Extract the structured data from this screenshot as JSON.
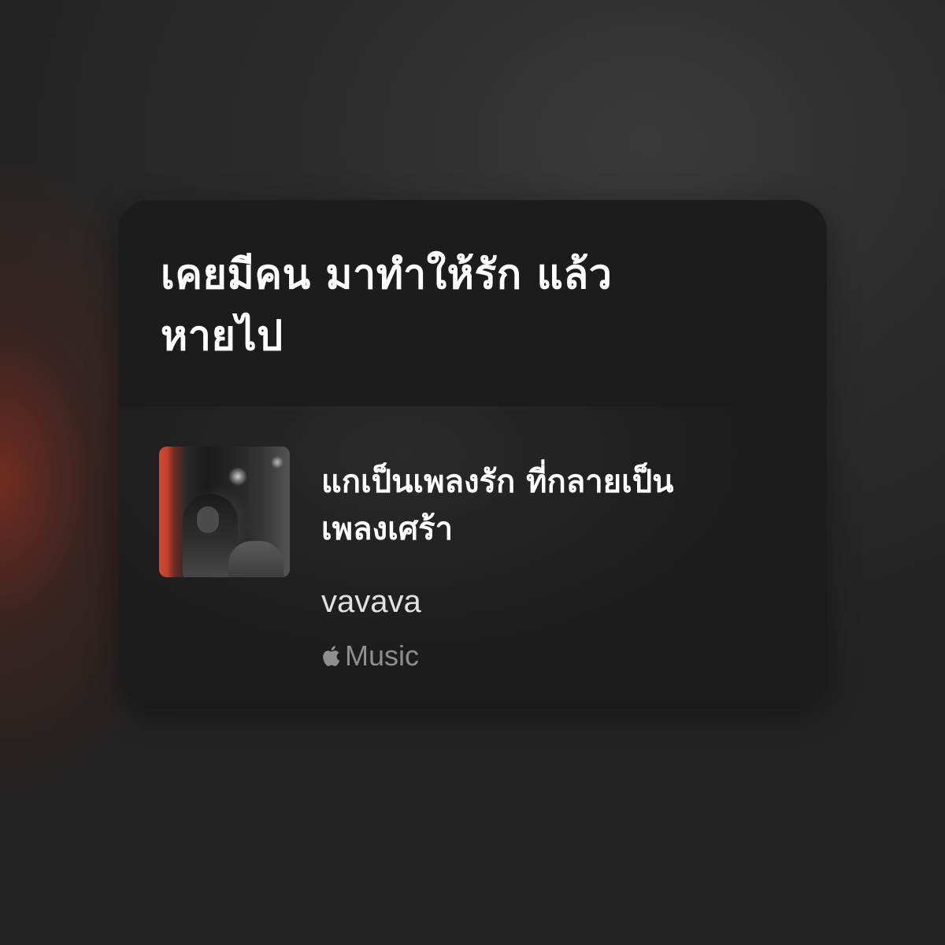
{
  "lyric": {
    "text": "เคยมีคน มาทำให้รัก แล้ว\nหายไป"
  },
  "song": {
    "title": "แกเป็นเพลงรัก ที่กลายเป็น\nเพลงเศร้า",
    "artist": "vavava",
    "service_label": "Music",
    "service_icon": "apple-logo-icon",
    "artwork_alt": "album-artwork"
  },
  "colors": {
    "background": "#242424",
    "card": "#1c1c1c",
    "accent_glow": "#b0341e",
    "text_primary": "#ffffff",
    "text_secondary": "#e2e2e2",
    "text_muted": "#8e8e8e"
  }
}
